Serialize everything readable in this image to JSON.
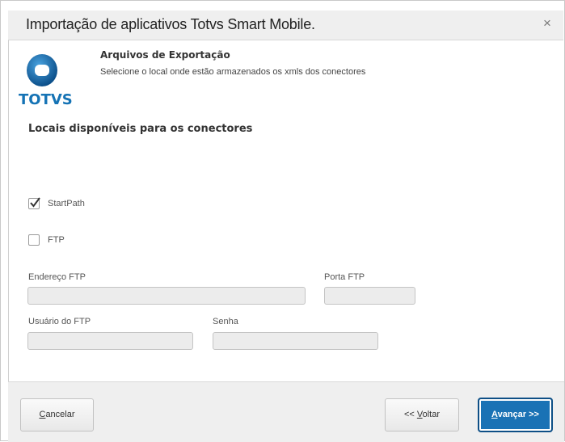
{
  "dialog": {
    "title": "Importação  de aplicativos Totvs Smart Mobile.",
    "close_label": "×"
  },
  "logo": {
    "text": "TOTVS",
    "icon": "totvs-logo-icon"
  },
  "header": {
    "title": "Arquivos de Exportação",
    "subtitle": "Selecione o local onde estão armazenados os xmls dos conectores"
  },
  "section": {
    "title": "Locais disponíveis para os conectores"
  },
  "options": {
    "startpath": {
      "label": "StartPath",
      "checked": true
    },
    "ftp": {
      "label": "FTP",
      "checked": false
    }
  },
  "fields": {
    "ftp_address": {
      "label": "Endereço FTP",
      "value": ""
    },
    "ftp_port": {
      "label": "Porta FTP",
      "value": ""
    },
    "ftp_user": {
      "label": "Usuário do FTP",
      "value": ""
    },
    "password": {
      "label": "Senha",
      "value": ""
    }
  },
  "buttons": {
    "cancel": {
      "mnemonic": "C",
      "rest": "ancelar"
    },
    "back": {
      "prefix": "<< ",
      "mnemonic": "V",
      "rest": "oltar"
    },
    "next": {
      "mnemonic": "A",
      "rest": "vançar >>"
    }
  },
  "colors": {
    "brand_blue": "#1a72b5",
    "title_bar": "#efefef"
  }
}
